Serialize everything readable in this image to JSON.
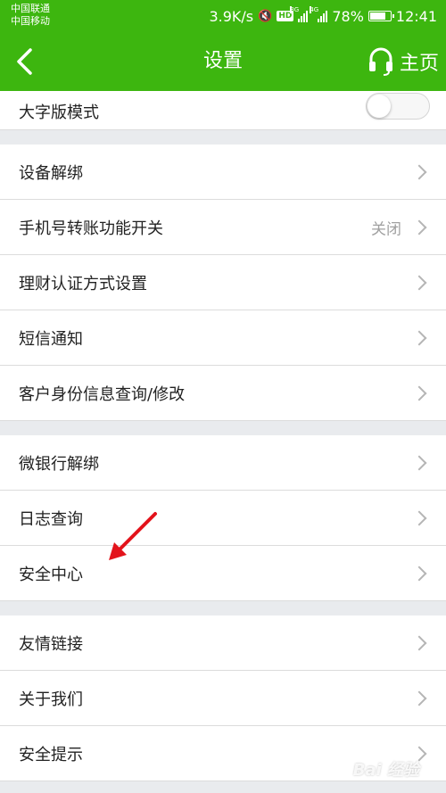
{
  "status_bar": {
    "carrier_1": "中国联通",
    "carrier_2": "中国移动",
    "network_speed": "3.9K/s",
    "hd": "HD",
    "signal_tag_1": "3G",
    "signal_tag_2": "4G",
    "battery_percent": "78%",
    "battery_level": 0.78,
    "time": "12:41"
  },
  "nav": {
    "title": "设置",
    "home_label": "主页",
    "back_icon": "chevron-left-icon",
    "home_icon": "headset-icon"
  },
  "groups": [
    {
      "items": [
        {
          "label": "大字版模式",
          "control": "toggle",
          "toggle_on": false
        }
      ]
    },
    {
      "items": [
        {
          "label": "设备解绑"
        },
        {
          "label": "手机号转账功能开关",
          "value": "关闭"
        },
        {
          "label": "理财认证方式设置"
        },
        {
          "label": "短信通知"
        },
        {
          "label": "客户身份信息查询/修改"
        }
      ]
    },
    {
      "items": [
        {
          "label": "微银行解绑"
        },
        {
          "label": "日志查询"
        },
        {
          "label": "安全中心"
        }
      ]
    },
    {
      "items": [
        {
          "label": "友情链接"
        },
        {
          "label": "关于我们"
        },
        {
          "label": "安全提示"
        }
      ]
    }
  ],
  "watermark": "Bai 经验",
  "colors": {
    "brand_green": "#3db60f",
    "background": "#e9ebee",
    "annotation_arrow": "#e3131b"
  }
}
